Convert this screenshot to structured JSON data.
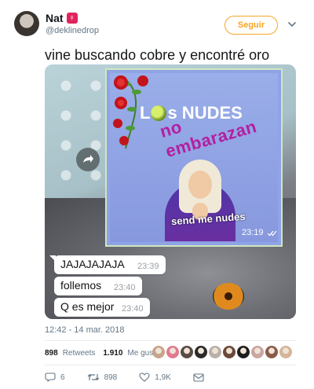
{
  "header": {
    "display_name": "Nat",
    "gender_symbol": "♀",
    "handle": "@deklinedrop",
    "follow_label": "Seguir",
    "icons": {
      "gender": "female-symbol-icon",
      "more": "chevron-down-icon"
    }
  },
  "tweet": {
    "text": "vine buscando cobre y encontré oro"
  },
  "media": {
    "card": {
      "title_prefix": "L",
      "title_suffix": "s NUDES",
      "subtitle": "no embarazan",
      "caption": "send me nudes",
      "time": "23:19"
    },
    "chat": [
      {
        "text": "JAJAJAJAJA",
        "time": "23:39"
      },
      {
        "text": "follemos",
        "time": "23:40"
      },
      {
        "text": "Q es mejor",
        "time": "23:40"
      }
    ]
  },
  "meta": {
    "timestamp": "12:42 - 14 mar. 2018",
    "retweets_count": "898",
    "retweets_label": "Retweets",
    "likes_count": "1.910",
    "likes_label": "Me gusta"
  },
  "actions": {
    "reply_count": "6",
    "retweet_count": "898",
    "like_count": "1,9K"
  },
  "colors": {
    "follow_accent": "#f5a623",
    "gender_badge": "#e0245e",
    "subtitle_magenta": "#b41fa0",
    "liker_avatars": [
      "#c7a48b",
      "#e27a8f",
      "#5a4b44",
      "#2a2a2a",
      "#b9b0a8",
      "#6b4a3a",
      "#1e1e1e",
      "#caa6a0",
      "#8a5b49",
      "#d6b49a"
    ]
  }
}
